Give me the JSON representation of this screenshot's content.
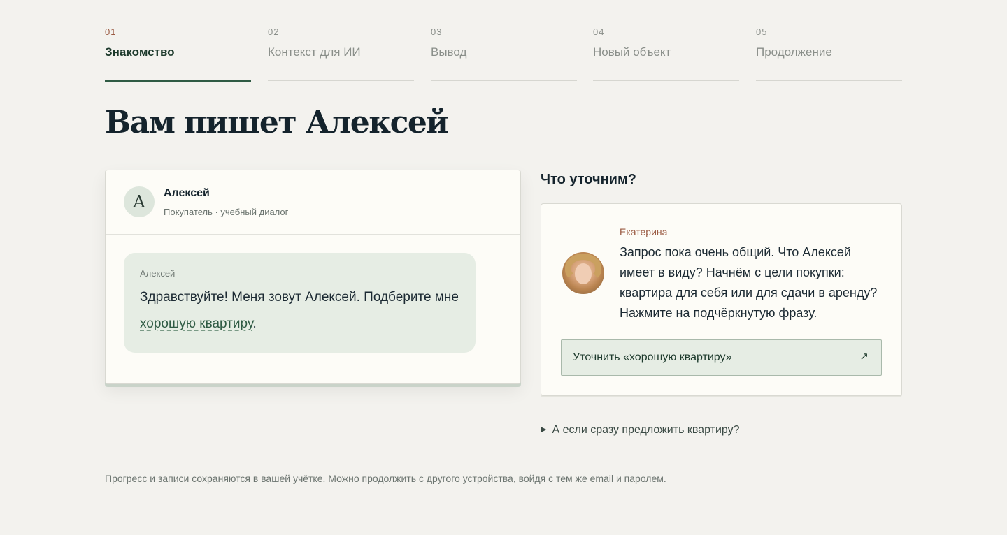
{
  "steps": [
    {
      "num": "01",
      "label": "Знакомство",
      "active": true
    },
    {
      "num": "02",
      "label": "Контекст для ИИ",
      "active": false
    },
    {
      "num": "03",
      "label": "Вывод",
      "active": false
    },
    {
      "num": "04",
      "label": "Новый объект",
      "active": false
    },
    {
      "num": "05",
      "label": "Продолжение",
      "active": false
    }
  ],
  "page": {
    "title": "Вам пишет Алексей"
  },
  "chat": {
    "avatar_letter": "А",
    "name": "Алексей",
    "subtitle": "Покупатель · учебный диалог",
    "message": {
      "author": "Алексей",
      "text_before": "Здравствуйте! Меня зовут Алексей. Подберите мне ",
      "phrase": "хорошую квартиру",
      "text_after": "."
    }
  },
  "clarify": {
    "heading": "Что уточним?",
    "tutor_name": "Екатерина",
    "tutor_text": "Запрос пока очень общий. Что Алексей имеет в виду? Начнём с цели покупки: квартира для себя или для сдачи в аренду? Нажмите на подчёркнутую фразу.",
    "button_label": "Уточнить «хорошую квартиру»",
    "button_icon": "↗",
    "details_label": "А если сразу предложить квартиру?",
    "details_icon": "▶"
  },
  "footer": {
    "note": "Прогресс и записи сохраняются в вашей учётке. Можно продолжить с другого устройства, войдя с тем же email и паролем."
  },
  "colors": {
    "background": "#f3f2ee",
    "accent_green": "#2f5b44",
    "accent_rust": "#9a5a42",
    "bubble": "#e6ede4"
  }
}
